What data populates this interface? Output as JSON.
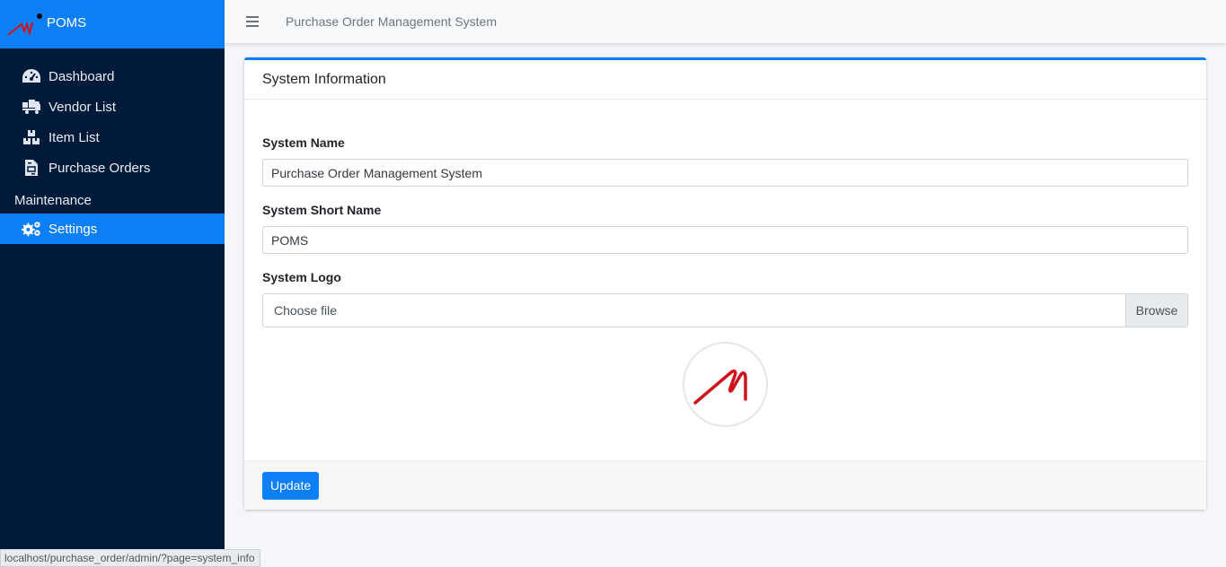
{
  "brand": {
    "name": "POMS"
  },
  "sidebar": {
    "items": [
      {
        "label": "Dashboard",
        "icon": "dashboard-icon"
      },
      {
        "label": "Vendor List",
        "icon": "truck-icon"
      },
      {
        "label": "Item List",
        "icon": "boxes-icon"
      },
      {
        "label": "Purchase Orders",
        "icon": "file-invoice-icon"
      }
    ],
    "section_header": "Maintenance",
    "active_item": {
      "label": "Settings",
      "icon": "cogs-icon"
    }
  },
  "topbar": {
    "title": "Purchase Order Management System"
  },
  "card": {
    "title": "System Information",
    "fields": {
      "system_name_label": "System Name",
      "system_name_value": "Purchase Order Management System",
      "short_name_label": "System Short Name",
      "short_name_value": "POMS",
      "logo_label": "System Logo",
      "file_placeholder": "Choose file",
      "browse_label": "Browse"
    },
    "update_label": "Update"
  },
  "status_bar": {
    "url": "localhost/purchase_order/admin/?page=system_info"
  },
  "colors": {
    "accent": "#0d7ff5",
    "sidebar": "#021a3a",
    "logo_red": "#d0121b"
  }
}
